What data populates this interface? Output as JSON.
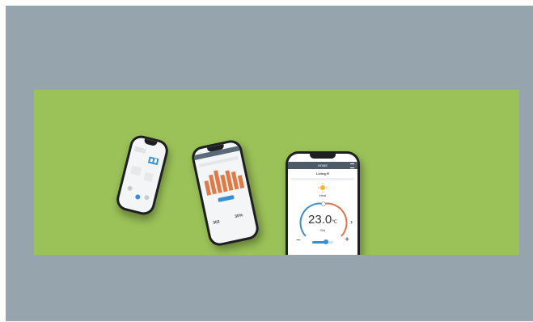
{
  "phone3": {
    "status_time": "9:41",
    "header": "HOME",
    "room": "Living R",
    "mode": "Heat",
    "temp_value": "23.0",
    "temp_unit": "℃",
    "set_label": "Set",
    "minus": "−",
    "plus": "+",
    "chevron_right": "›",
    "chevron_left": "‹"
  },
  "phone2": {
    "value_left": "302",
    "value_right": "30%"
  },
  "colors": {
    "banner": "#9bc258",
    "frame": "#95a4ad",
    "arc_warm": "#e0714f",
    "arc_cool": "#3a8fd0",
    "slider": "#3a8fd0",
    "bars": "#e07a44"
  }
}
